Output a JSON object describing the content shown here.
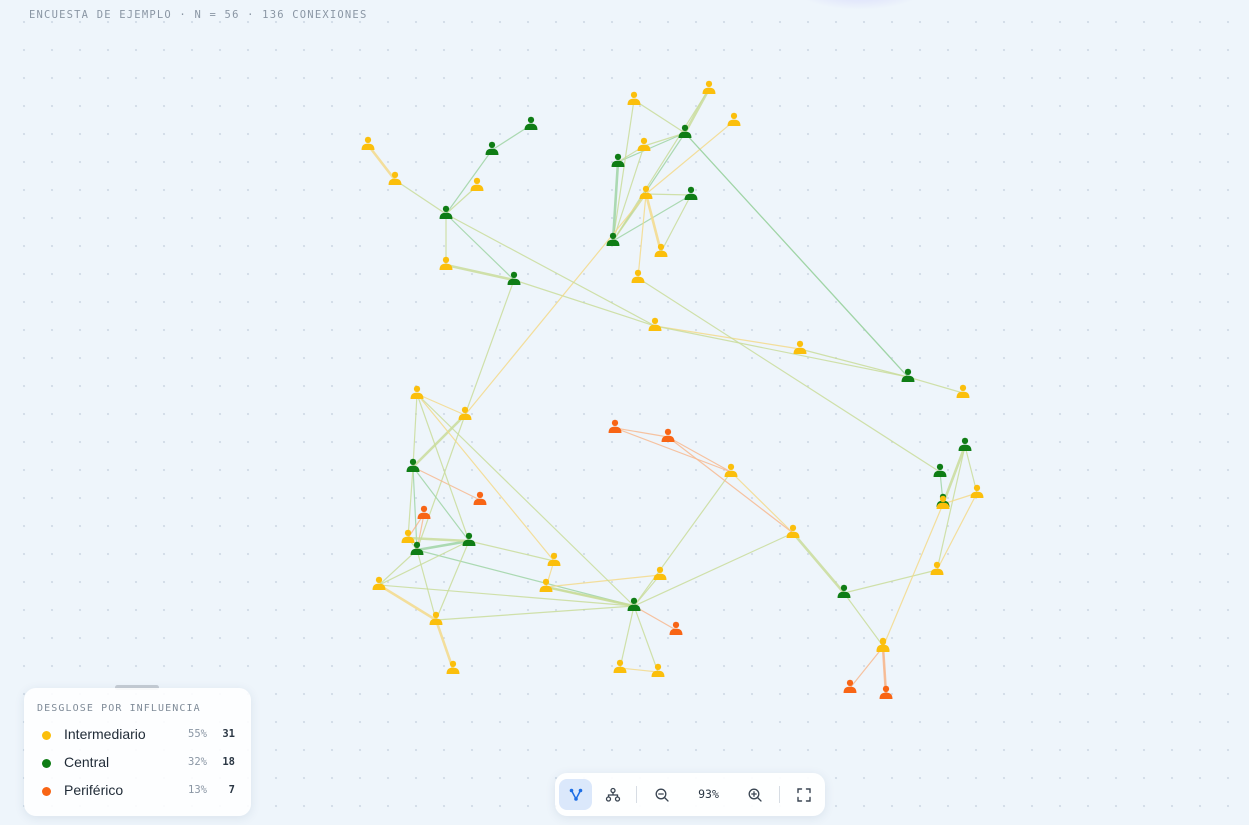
{
  "header": {
    "caption": "ENCUESTA DE EJEMPLO · N = 56 · 136 CONEXIONES"
  },
  "legend": {
    "title": "DESGLOSE POR INFLUENCIA",
    "items": [
      {
        "key": "intermediario",
        "label": "Intermediario",
        "pct": "55%",
        "count": "31",
        "color": "#fbbf0c"
      },
      {
        "key": "central",
        "label": "Central",
        "pct": "32%",
        "count": "18",
        "color": "#0f7d15"
      },
      {
        "key": "periferico",
        "label": "Periférico",
        "pct": "13%",
        "count": "7",
        "color": "#f86515"
      }
    ]
  },
  "toolbar": {
    "zoom_level": "93%",
    "buttons": [
      {
        "name": "network-view",
        "icon": "network-graph-icon",
        "active": true
      },
      {
        "name": "hierarchy-view",
        "icon": "hierarchy-tree-icon",
        "active": false
      },
      {
        "name": "zoom-out",
        "icon": "zoom-out-icon",
        "active": false
      },
      {
        "name": "zoom-in",
        "icon": "zoom-in-icon",
        "active": false
      },
      {
        "name": "fullscreen",
        "icon": "fullscreen-icon",
        "active": false
      }
    ]
  },
  "colors": {
    "intermediario": "#fbbf0c",
    "central": "#0f7d15",
    "periferico": "#f86515",
    "accent": "#1d6ee5"
  },
  "network": {
    "node_icon": "person-icon",
    "nodes": [
      {
        "id": 1,
        "type": "intermediario"
      },
      {
        "id": 2,
        "type": "intermediario"
      },
      {
        "id": 3,
        "type": "central"
      },
      {
        "id": 4,
        "type": "central"
      },
      {
        "id": 5,
        "type": "intermediario"
      },
      {
        "id": 6,
        "type": "central"
      },
      {
        "id": 7,
        "type": "intermediario"
      },
      {
        "id": 8,
        "type": "central"
      },
      {
        "id": 9,
        "type": "intermediario"
      },
      {
        "id": 10,
        "type": "intermediario"
      },
      {
        "id": 11,
        "type": "central"
      },
      {
        "id": 12,
        "type": "intermediario"
      },
      {
        "id": 13,
        "type": "intermediario"
      },
      {
        "id": 14,
        "type": "central"
      },
      {
        "id": 15,
        "type": "intermediario"
      },
      {
        "id": 16,
        "type": "central"
      },
      {
        "id": 17,
        "type": "central"
      },
      {
        "id": 18,
        "type": "intermediario"
      },
      {
        "id": 19,
        "type": "intermediario"
      },
      {
        "id": 20,
        "type": "intermediario"
      },
      {
        "id": 21,
        "type": "central"
      },
      {
        "id": 22,
        "type": "intermediario"
      },
      {
        "id": 23,
        "type": "intermediario"
      },
      {
        "id": 24,
        "type": "central"
      },
      {
        "id": 25,
        "type": "central"
      },
      {
        "id": 26,
        "type": "periferico"
      },
      {
        "id": 27,
        "type": "periferico"
      },
      {
        "id": 28,
        "type": "intermediario"
      },
      {
        "id": 29,
        "type": "central"
      },
      {
        "id": 30,
        "type": "central"
      },
      {
        "id": 31,
        "type": "intermediario"
      },
      {
        "id": 32,
        "type": "central"
      },
      {
        "id": 33,
        "type": "intermediario"
      },
      {
        "id": 34,
        "type": "intermediario"
      },
      {
        "id": 35,
        "type": "intermediario"
      },
      {
        "id": 36,
        "type": "periferico"
      },
      {
        "id": 37,
        "type": "intermediario"
      },
      {
        "id": 38,
        "type": "intermediario"
      },
      {
        "id": 39,
        "type": "intermediario"
      },
      {
        "id": 40,
        "type": "central"
      },
      {
        "id": 41,
        "type": "periferico"
      },
      {
        "id": 42,
        "type": "intermediario"
      },
      {
        "id": 43,
        "type": "intermediario"
      },
      {
        "id": 44,
        "type": "central"
      },
      {
        "id": 45,
        "type": "periferico"
      },
      {
        "id": 46,
        "type": "intermediario"
      },
      {
        "id": 47,
        "type": "intermediario"
      },
      {
        "id": 48,
        "type": "central"
      },
      {
        "id": 49,
        "type": "intermediario"
      },
      {
        "id": 50,
        "type": "intermediario"
      },
      {
        "id": 51,
        "type": "intermediario"
      },
      {
        "id": 52,
        "type": "periferico"
      },
      {
        "id": 53,
        "type": "periferico"
      },
      {
        "id": 54,
        "type": "intermediario"
      },
      {
        "id": 55,
        "type": "intermediario"
      },
      {
        "id": 56,
        "type": "intermediario"
      }
    ],
    "edges": [
      [
        1,
        2
      ],
      [
        2,
        6
      ],
      [
        3,
        4
      ],
      [
        4,
        6
      ],
      [
        5,
        6
      ],
      [
        6,
        7
      ],
      [
        6,
        8
      ],
      [
        7,
        8
      ],
      [
        8,
        9
      ],
      [
        9,
        10
      ],
      [
        9,
        14
      ],
      [
        10,
        14
      ],
      [
        14,
        15
      ],
      [
        11,
        12
      ],
      [
        11,
        13
      ],
      [
        11,
        14
      ],
      [
        11,
        16
      ],
      [
        11,
        17
      ],
      [
        11,
        18
      ],
      [
        12,
        16
      ],
      [
        13,
        16
      ],
      [
        16,
        17
      ],
      [
        16,
        18
      ],
      [
        16,
        20
      ],
      [
        16,
        21
      ],
      [
        17,
        18
      ],
      [
        19,
        20
      ],
      [
        20,
        21
      ],
      [
        20,
        22
      ],
      [
        21,
        22
      ],
      [
        20,
        23
      ],
      [
        23,
        24
      ],
      [
        24,
        25
      ],
      [
        20,
        28
      ],
      [
        8,
        28
      ],
      [
        28,
        29
      ],
      [
        28,
        33
      ],
      [
        28,
        30
      ],
      [
        29,
        30
      ],
      [
        29,
        27
      ],
      [
        30,
        26
      ],
      [
        30,
        31
      ],
      [
        30,
        32
      ],
      [
        26,
        31
      ],
      [
        29,
        31
      ],
      [
        29,
        32
      ],
      [
        30,
        34
      ],
      [
        30,
        35
      ],
      [
        30,
        40
      ],
      [
        31,
        32
      ],
      [
        32,
        34
      ],
      [
        32,
        33
      ],
      [
        32,
        37
      ],
      [
        33,
        37
      ],
      [
        40,
        34
      ],
      [
        40,
        35
      ],
      [
        40,
        38
      ],
      [
        40,
        39
      ],
      [
        40,
        43
      ],
      [
        40,
        41
      ],
      [
        38,
        39
      ],
      [
        40,
        42
      ],
      [
        42,
        43
      ],
      [
        43,
        44
      ],
      [
        44,
        46
      ],
      [
        42,
        36
      ],
      [
        44,
        47
      ],
      [
        47,
        48
      ],
      [
        47,
        49
      ],
      [
        48,
        49
      ],
      [
        48,
        50
      ],
      [
        49,
        50
      ],
      [
        50,
        51
      ],
      [
        51,
        52
      ],
      [
        51,
        53
      ],
      [
        46,
        51
      ],
      [
        45,
        43
      ],
      [
        35,
        34
      ],
      [
        38,
        40
      ],
      [
        14,
        11
      ],
      [
        6,
        9
      ]
    ]
  }
}
